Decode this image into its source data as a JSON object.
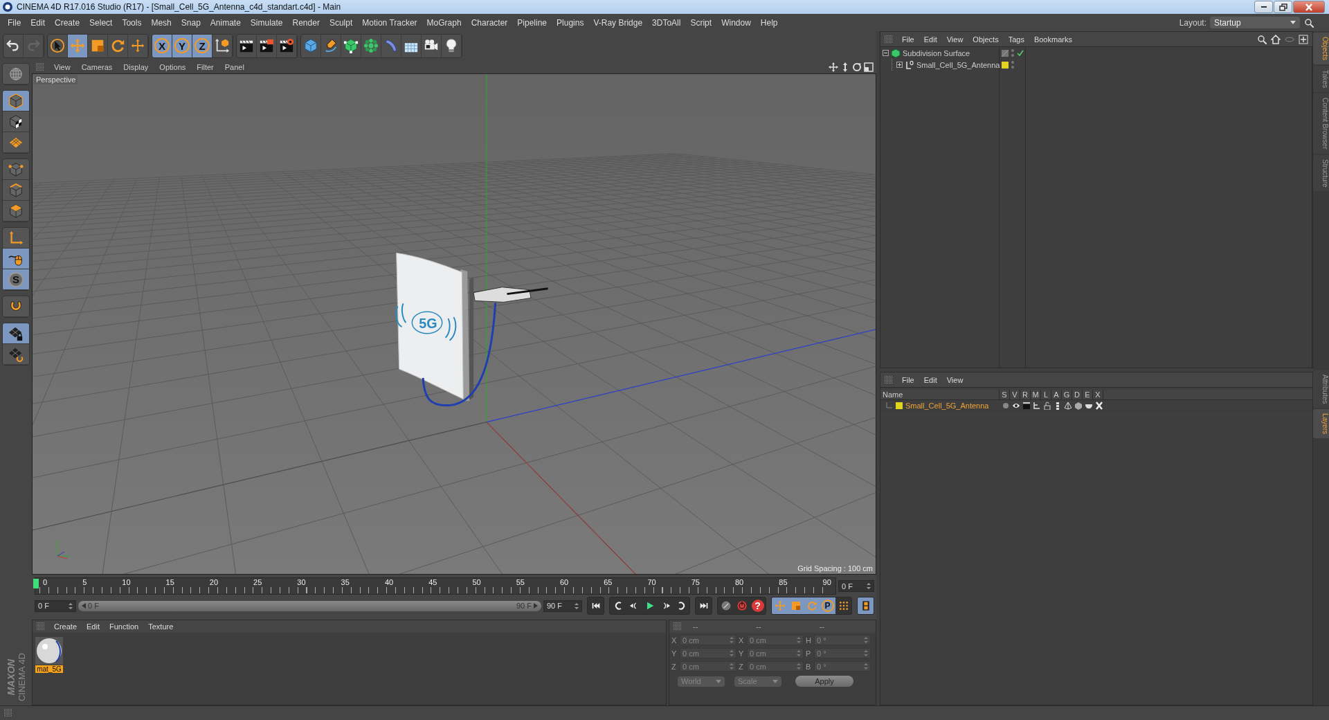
{
  "window": {
    "title": "CINEMA 4D R17.016 Studio (R17) - [Small_Cell_5G_Antenna_c4d_standart.c4d] - Main"
  },
  "menu": [
    "File",
    "Edit",
    "Create",
    "Select",
    "Tools",
    "Mesh",
    "Snap",
    "Animate",
    "Simulate",
    "Render",
    "Sculpt",
    "Motion Tracker",
    "MoGraph",
    "Character",
    "Pipeline",
    "Plugins",
    "V-Ray Bridge",
    "3DToAll",
    "Script",
    "Window",
    "Help"
  ],
  "layout": {
    "label": "Layout:",
    "value": "Startup"
  },
  "toolbar": [
    [
      {
        "kind": "undo",
        "selected": false
      },
      {
        "kind": "redo",
        "selected": false
      }
    ],
    [
      {
        "kind": "select",
        "selected": false
      },
      {
        "kind": "move",
        "selected": true
      },
      {
        "kind": "scale",
        "selected": false
      },
      {
        "kind": "rotate",
        "selected": false
      },
      {
        "kind": "transform",
        "selected": false
      }
    ],
    [
      {
        "kind": "axis",
        "label": "X",
        "selected": true
      },
      {
        "kind": "axis",
        "label": "Y",
        "selected": true
      },
      {
        "kind": "axis",
        "label": "Z",
        "selected": true
      },
      {
        "kind": "coord",
        "selected": false
      }
    ],
    [
      {
        "kind": "rview",
        "selected": false
      },
      {
        "kind": "rpic",
        "selected": false
      },
      {
        "kind": "rset",
        "selected": false
      }
    ],
    [
      {
        "kind": "cube",
        "selected": false
      },
      {
        "kind": "pen",
        "selected": false
      },
      {
        "kind": "subdiv",
        "selected": false
      },
      {
        "kind": "cloner",
        "selected": false
      },
      {
        "kind": "deformer",
        "selected": false
      },
      {
        "kind": "floor",
        "selected": false
      },
      {
        "kind": "camera",
        "selected": false
      },
      {
        "kind": "light",
        "selected": false
      }
    ]
  ],
  "left_tools": [
    [
      {
        "kind": "model",
        "selected": false
      }
    ],
    [
      {
        "kind": "object",
        "selected": true
      },
      {
        "kind": "texture",
        "selected": false
      },
      {
        "kind": "workplane",
        "selected": false
      }
    ],
    [
      {
        "kind": "points",
        "selected": false
      },
      {
        "kind": "edges",
        "selected": false
      },
      {
        "kind": "polys",
        "selected": false
      }
    ],
    [
      {
        "kind": "axes",
        "selected": false
      },
      {
        "kind": "tweak",
        "selected": true
      },
      {
        "kind": "snap",
        "label": "S",
        "selected": true
      }
    ],
    [
      {
        "kind": "magnet",
        "selected": false
      }
    ],
    [
      {
        "kind": "lockgrid",
        "selected": true
      },
      {
        "kind": "planar",
        "selected": false
      }
    ]
  ],
  "brand": {
    "company": "MAXON",
    "product": "CINEMA 4D"
  },
  "viewport": {
    "menu": [
      "View",
      "Cameras",
      "Display",
      "Options",
      "Filter",
      "Panel"
    ],
    "camera": "Perspective",
    "model_label": "5G",
    "grid_spacing": "Grid Spacing : 100 cm"
  },
  "timeline": {
    "ticks": [
      "0",
      "5",
      "10",
      "15",
      "20",
      "25",
      "30",
      "35",
      "40",
      "45",
      "50",
      "55",
      "60",
      "65",
      "70",
      "75",
      "80",
      "85",
      "90"
    ],
    "level": 0,
    "current": "0 F",
    "start": "0 F",
    "range": {
      "start": "0 F",
      "end": "90 F",
      "level": 1
    },
    "end": "90 F",
    "transport": [
      {
        "kind": "first"
      },
      {
        "kind": "prevkey"
      },
      {
        "kind": "prev"
      },
      {
        "kind": "play"
      },
      {
        "kind": "next"
      },
      {
        "kind": "nextkey"
      },
      {
        "kind": "last"
      }
    ],
    "keys": [
      {
        "kind": "keyoff",
        "selected": false
      },
      {
        "kind": "record",
        "selected": false
      },
      {
        "kind": "autokey",
        "label": "?",
        "selected": false
      },
      {
        "kind": "move",
        "selected": true
      },
      {
        "kind": "scale",
        "selected": true
      },
      {
        "kind": "rotate",
        "selected": true
      },
      {
        "kind": "param",
        "label": "P",
        "selected": true
      },
      {
        "kind": "dots",
        "selected": false
      },
      {
        "kind": "film",
        "selected": true
      }
    ]
  },
  "materials": {
    "menu": [
      "Create",
      "Edit",
      "Function",
      "Texture"
    ],
    "items": [
      {
        "name": "mat_5G",
        "selected": true
      }
    ]
  },
  "coordinates": {
    "headers": [
      "--",
      "--",
      "--"
    ],
    "rows": [
      {
        "axis": "X",
        "value": "0 cm",
        "axis_2": "X",
        "value_2": "0 cm",
        "axis_3": "H",
        "value_3": "0 °"
      },
      {
        "axis": "Y",
        "value": "0 cm",
        "axis_2": "Y",
        "value_2": "0 cm",
        "axis_3": "P",
        "value_3": "0 °"
      },
      {
        "axis": "Z",
        "value": "0 cm",
        "axis_2": "Z",
        "value_2": "0 cm",
        "axis_3": "B",
        "value_3": "0 °"
      }
    ],
    "space": "World",
    "mode": "Scale",
    "apply": "Apply"
  },
  "objects": {
    "menu": [
      "File",
      "Edit",
      "View",
      "Objects",
      "Tags",
      "Bookmarks"
    ],
    "tree": [
      {
        "name": "Subdivision Surface",
        "kind": "subdivision",
        "expanded": true,
        "checked": true,
        "children": [
          {
            "name": "Small_Cell_5G_Antenna",
            "kind": "null",
            "expanded": false,
            "checked": false,
            "color": "#e2d41c"
          }
        ]
      }
    ]
  },
  "layers": {
    "menu": [
      "File",
      "Edit",
      "View"
    ],
    "columns": [
      "Name",
      "S",
      "V",
      "R",
      "M",
      "L",
      "A",
      "G",
      "D",
      "E",
      "X"
    ],
    "items": [
      {
        "name": "Small_Cell_5G_Antenna",
        "color": "#e2d41c"
      }
    ]
  },
  "side_tabs": [
    [
      {
        "label": "Objects",
        "selected": true
      },
      {
        "label": "Takes",
        "selected": false
      },
      {
        "label": "Content Browser",
        "selected": false
      },
      {
        "label": "Structure",
        "selected": false
      }
    ],
    [
      {
        "label": "Attributes",
        "selected": false
      },
      {
        "label": "Layers",
        "selected": true
      }
    ]
  ]
}
